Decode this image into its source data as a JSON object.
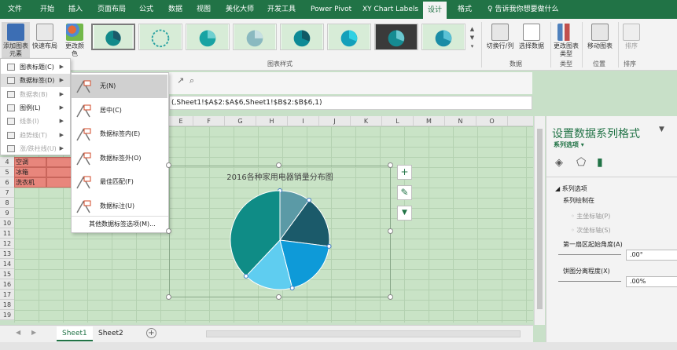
{
  "tabs": [
    "文件",
    "开始",
    "插入",
    "页面布局",
    "公式",
    "数据",
    "视图",
    "美化大师",
    "开发工具",
    "Power Pivot",
    "XY Chart Labels",
    "设计",
    "格式"
  ],
  "active_tab": "设计",
  "tell_me": "告诉我你想要做什么",
  "ribbon": {
    "add_element": "添加图表元素",
    "quick_layout": "快速布局",
    "change_colors": "更改颜色",
    "chart_styles_label": "图表样式",
    "switch_row_col": "切换行/列",
    "select_data": "选择数据",
    "data_group": "数据",
    "change_type": "更改图表类型",
    "type_group": "类型",
    "move_chart": "移动图表",
    "location_group": "位置",
    "sort": "排序",
    "sort_group": "排序"
  },
  "element_menu": [
    {
      "label": "图表标题(C)",
      "disabled": false,
      "arrow": true
    },
    {
      "label": "数据标签(D)",
      "disabled": false,
      "arrow": true,
      "highlighted": true
    },
    {
      "label": "数据表(B)",
      "disabled": true,
      "arrow": true
    },
    {
      "label": "图例(L)",
      "disabled": false,
      "arrow": true
    },
    {
      "label": "线条(I)",
      "disabled": true,
      "arrow": true
    },
    {
      "label": "趋势线(T)",
      "disabled": true,
      "arrow": true
    },
    {
      "label": "涨/跌柱线(U)",
      "disabled": true,
      "arrow": true
    }
  ],
  "label_submenu": [
    {
      "label": "无(N)",
      "highlighted": true
    },
    {
      "label": "居中(C)"
    },
    {
      "label": "数据标签内(E)"
    },
    {
      "label": "数据标签外(O)"
    },
    {
      "label": "最佳匹配(F)"
    },
    {
      "label": "数据标注(U)"
    }
  ],
  "label_submenu_more": "其他数据标签选项(M)...",
  "formula": "(,Sheet1!$A$2:$A$6,Sheet1!$B$2:$B$6,1)",
  "columns": [
    "E",
    "F",
    "G",
    "H",
    "I",
    "J",
    "K",
    "L",
    "M",
    "N",
    "O"
  ],
  "rows": [
    "4",
    "5",
    "6",
    "7",
    "8",
    "9",
    "10",
    "11",
    "12",
    "13",
    "14",
    "15",
    "16",
    "17",
    "18",
    "19"
  ],
  "cells": [
    "空调",
    "冰箱",
    "洗衣机"
  ],
  "chart": {
    "title": "2016各种家用电器销量分布图",
    "side_buttons": [
      "+",
      "✎",
      "▼"
    ]
  },
  "chart_data": {
    "type": "pie",
    "title": "2016各种家用电器销量分布图",
    "labels": [],
    "values": [
      10,
      17,
      19,
      16,
      38
    ],
    "colors": [
      "#5b9aa6",
      "#1b5a6a",
      "#0e9ad8",
      "#5fcdf0",
      "#0f8c86"
    ],
    "legend": "none"
  },
  "pane": {
    "title": "设置数据系列格式",
    "subtitle": "系列选项",
    "section": "系列选项",
    "plot_on": "系列绘制在",
    "primary_axis": "主坐标轴(P)",
    "secondary_axis": "次坐标轴(S)",
    "first_slice_angle": "第一扇区起始角度(A)",
    "angle_value": ".00°",
    "explosion": "饼图分离程度(X)",
    "explosion_value": ".00%"
  },
  "sheets": [
    "Sheet1",
    "Sheet2"
  ],
  "active_sheet": "Sheet1"
}
